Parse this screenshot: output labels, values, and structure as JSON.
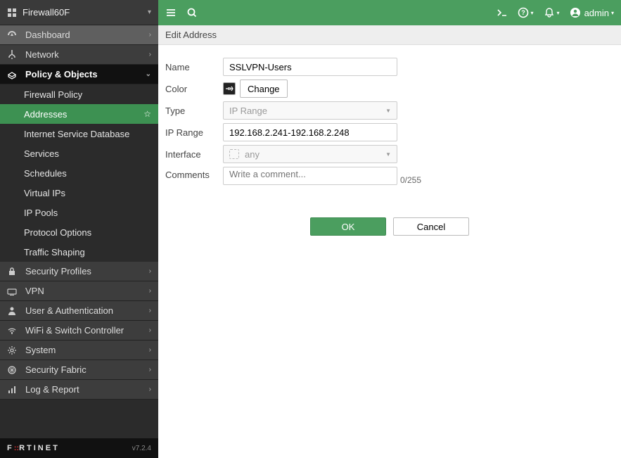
{
  "device_name": "Firewall60F",
  "brand": "FORTINET",
  "version": "v7.2.4",
  "admin_user": "admin",
  "sidebar": {
    "items": [
      {
        "label": "Dashboard",
        "icon": "dashboard"
      },
      {
        "label": "Network",
        "icon": "network"
      },
      {
        "label": "Policy & Objects",
        "icon": "policy"
      },
      {
        "label": "Security Profiles",
        "icon": "lock"
      },
      {
        "label": "VPN",
        "icon": "vpn"
      },
      {
        "label": "User & Authentication",
        "icon": "user"
      },
      {
        "label": "WiFi & Switch Controller",
        "icon": "wifi"
      },
      {
        "label": "System",
        "icon": "gear"
      },
      {
        "label": "Security Fabric",
        "icon": "fabric"
      },
      {
        "label": "Log & Report",
        "icon": "report"
      }
    ],
    "sub_policy": [
      {
        "label": "Firewall Policy"
      },
      {
        "label": "Addresses"
      },
      {
        "label": "Internet Service Database"
      },
      {
        "label": "Services"
      },
      {
        "label": "Schedules"
      },
      {
        "label": "Virtual IPs"
      },
      {
        "label": "IP Pools"
      },
      {
        "label": "Protocol Options"
      },
      {
        "label": "Traffic Shaping"
      }
    ]
  },
  "subheader_title": "Edit Address",
  "form": {
    "name_label": "Name",
    "name_value": "SSLVPN-Users",
    "color_label": "Color",
    "change_label": "Change",
    "type_label": "Type",
    "type_value": "IP Range",
    "iprange_label": "IP Range",
    "iprange_value": "192.168.2.241-192.168.2.248",
    "interface_label": "Interface",
    "interface_value": "any",
    "comments_label": "Comments",
    "comments_placeholder": "Write a comment...",
    "comments_counter": "0/255"
  },
  "buttons": {
    "ok": "OK",
    "cancel": "Cancel"
  }
}
